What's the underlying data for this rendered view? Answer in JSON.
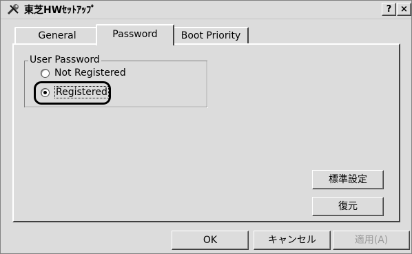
{
  "window": {
    "title": "東芝HWｾｯﾄｱｯﾌﾟ",
    "help_button": "?",
    "close_button": "×",
    "icon": "wrench-icon"
  },
  "tabs": [
    {
      "label": "General",
      "active": false
    },
    {
      "label": "Password",
      "active": true
    },
    {
      "label": "Boot Priority",
      "active": false
    }
  ],
  "user_password": {
    "group_label": "User Password",
    "options": [
      {
        "label": "Not Registered",
        "checked": false
      },
      {
        "label": "Registered",
        "checked": true
      }
    ]
  },
  "panel_buttons": {
    "default_settings": "標準設定",
    "restore": "復元"
  },
  "dialog_buttons": {
    "ok": "OK",
    "cancel": "キャンセル",
    "apply": "適用(A)",
    "apply_enabled": false
  }
}
